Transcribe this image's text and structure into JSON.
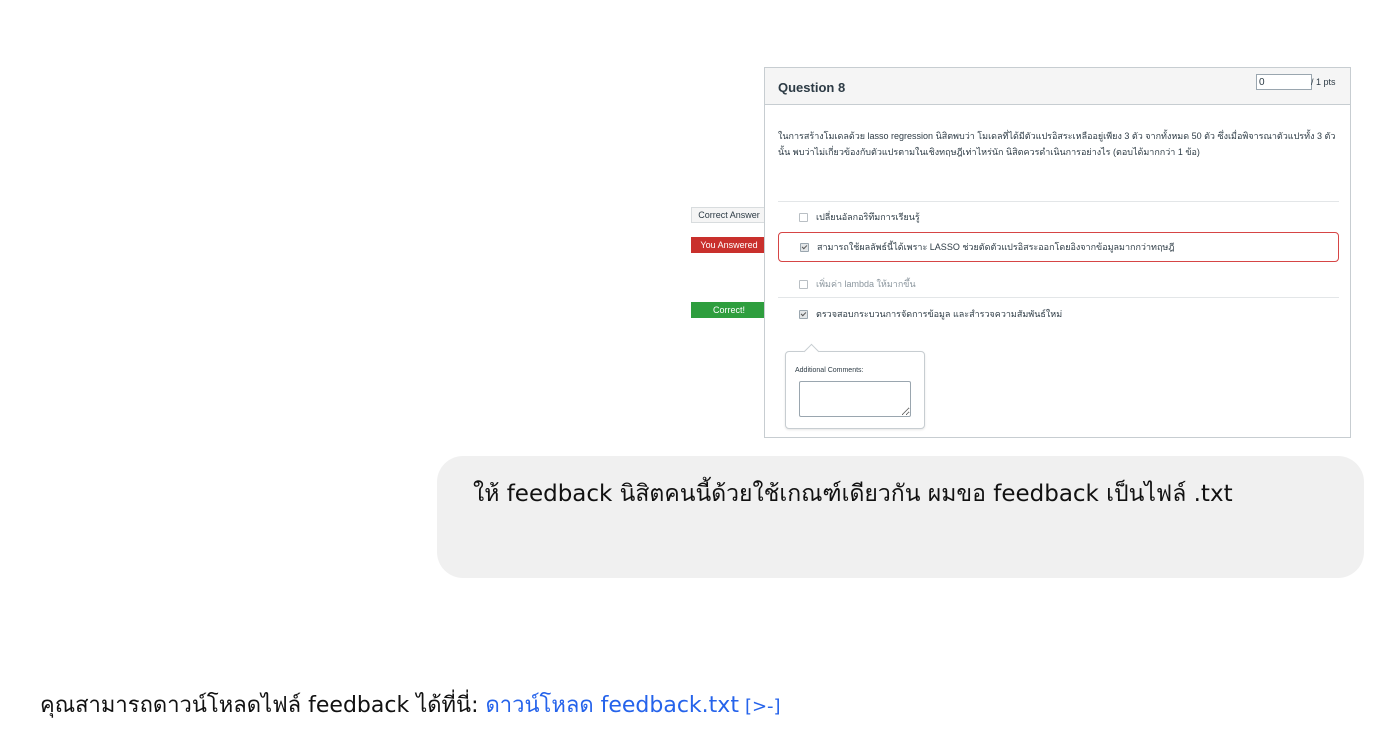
{
  "quiz": {
    "title": "Question 8",
    "points_value": "0",
    "points_suffix": "/ 1 pts",
    "question_text": "ในการสร้างโมเดลด้วย lasso regression นิสิตพบว่า โมเดลที่ได้มีตัวแปรอิสระเหลืออยู่เพียง 3 ตัว จากทั้งหมด 50 ตัว ซึ่งเมื่อพิจารณาตัวแปรทั้ง 3 ตัวนั้น พบว่าไม่เกี่ยวข้องกับตัวแปรตามในเชิงทฤษฎีเท่าไหร่นัก นิสิตควรดำเนินการอย่างไร (ตอบได้มากกว่า 1 ข้อ)",
    "answers": [
      {
        "text": "เปลี่ยนอัลกอริทึมการเรียนรู้",
        "checked": false,
        "status": "correct-answer"
      },
      {
        "text": "สามารถใช้ผลลัพธ์นี้ได้เพราะ LASSO ช่วยตัดตัวแปรอิสระออกโดยอิงจากข้อมูลมากกว่าทฤษฎี",
        "checked": true,
        "status": "you-answered"
      },
      {
        "text": "เพิ่มค่า lambda ให้มากขึ้น",
        "checked": false,
        "status": "none"
      },
      {
        "text": "ตรวจสอบกระบวนการจัดการข้อมูล และสำรวจความสัมพันธ์ใหม่",
        "checked": true,
        "status": "correct"
      }
    ],
    "flags": {
      "correct_answer": "Correct Answer",
      "you_answered": "You Answered",
      "correct": "Correct!"
    },
    "comments_label": "Additional Comments:"
  },
  "chat": {
    "user_message": "ให้ feedback นิสิตคนนี้ด้วยใช้เกณฑ์เดียวกัน ผมขอ feedback เป็นไฟล์ .txt"
  },
  "reply": {
    "prefix": "คุณสามารถดาวน์โหลดไฟล์ feedback ได้ที่นี่: ",
    "link_text": "ดาวน์โหลด feedback.txt",
    "link_icon": "download-icon"
  },
  "colors": {
    "wrong": "#c9302c",
    "correct": "#2e9e3e",
    "link": "#2563eb"
  }
}
